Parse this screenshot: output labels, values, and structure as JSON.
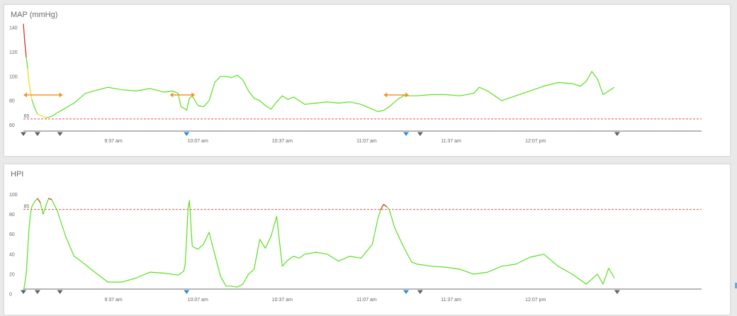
{
  "chart_data": [
    {
      "type": "line",
      "title": "MAP (mmHg)",
      "xlabel": "",
      "ylabel": "",
      "ylim": [
        55,
        150
      ],
      "yticks": [
        60,
        80,
        100,
        120,
        140
      ],
      "xlim_minutes": [
        0,
        240
      ],
      "x_tick_labels": [
        "9:37 am",
        "10:07 am",
        "10:37 am",
        "11:07 am",
        "11:37 am",
        "12:07 pm"
      ],
      "x_tick_minutes": [
        32,
        62,
        92,
        122,
        152,
        182
      ],
      "threshold": {
        "value": 65,
        "label": "65",
        "color": "#e05555"
      },
      "colors": {
        "normal": "#58e01c",
        "warning": "#f5e23c",
        "alarm": "#d93a3a"
      },
      "series": [
        {
          "x": [
            0,
            0.5,
            1,
            1.5,
            2,
            3,
            4,
            5,
            6,
            8,
            10,
            12,
            15,
            18,
            20,
            22,
            25,
            30,
            35,
            40,
            45,
            50,
            53,
            55,
            56,
            57,
            58,
            59,
            60,
            62,
            64,
            66,
            68,
            70,
            72,
            74,
            76,
            78,
            80,
            82,
            84,
            86,
            88,
            90,
            92,
            94,
            96,
            98,
            100,
            104,
            108,
            112,
            116,
            120,
            122,
            124,
            126,
            128,
            130,
            133,
            135,
            140,
            145,
            150,
            155,
            160,
            162,
            165,
            170,
            175,
            180,
            185,
            190,
            195,
            198,
            200,
            202,
            204,
            206,
            208,
            210
          ],
          "y": [
            143,
            128,
            116,
            106,
            95,
            81,
            74,
            69,
            68,
            66,
            67,
            70,
            74,
            78,
            82,
            86,
            88,
            91,
            89,
            88,
            90,
            87,
            88,
            86,
            75,
            74,
            72,
            82,
            84,
            76,
            75,
            80,
            95,
            100,
            100,
            99,
            101,
            97,
            88,
            82,
            80,
            76,
            73,
            79,
            84,
            81,
            83,
            80,
            77,
            78,
            79,
            78,
            79,
            77,
            75,
            73,
            71,
            72,
            75,
            81,
            84,
            84,
            85,
            85,
            84,
            86,
            91,
            88,
            80,
            84,
            88,
            92,
            95,
            94,
            92,
            96,
            104,
            98,
            85,
            88,
            91
          ],
          "alarm_points": [
            0,
            0.5,
            1
          ],
          "warning_points": [
            1.5,
            2,
            3,
            5,
            6,
            8,
            204
          ]
        }
      ],
      "event_arrows_minutes": [
        [
          0,
          14
        ],
        [
          52,
          61
        ],
        [
          128,
          137
        ]
      ],
      "markers_gray_minutes": [
        0,
        5,
        13,
        141,
        211
      ],
      "markers_blue_minutes": [
        58,
        136
      ]
    },
    {
      "type": "line",
      "title": "HPI",
      "xlabel": "",
      "ylabel": "",
      "ylim": [
        0,
        105
      ],
      "yticks": [
        0,
        20,
        40,
        60,
        80,
        100
      ],
      "xlim_minutes": [
        0,
        240
      ],
      "x_tick_labels": [
        "9:37 am",
        "10:07 am",
        "10:37 am",
        "11:07 am",
        "11:37 am",
        "12:07 pm"
      ],
      "x_tick_minutes": [
        32,
        62,
        92,
        122,
        152,
        182
      ],
      "threshold": {
        "value": 85,
        "label": "85",
        "color": "#e05555"
      },
      "colors": {
        "normal": "#58e01c",
        "alarm": "#d93a3a"
      },
      "series": [
        {
          "x": [
            0,
            1,
            2,
            2.5,
            3,
            4,
            5,
            6,
            7,
            8,
            9,
            10,
            12,
            15,
            18,
            20,
            24,
            30,
            35,
            40,
            45,
            50,
            55,
            57,
            57.5,
            58,
            58.5,
            59,
            60,
            62,
            64,
            66,
            68,
            70,
            72,
            74,
            76,
            78,
            80,
            82,
            84,
            86,
            88,
            90,
            92,
            94,
            96,
            98,
            100,
            104,
            108,
            112,
            116,
            120,
            124,
            126,
            127,
            128,
            129,
            130,
            132,
            135,
            138,
            140,
            145,
            150,
            155,
            160,
            165,
            170,
            175,
            180,
            185,
            190,
            195,
            200,
            202,
            204,
            206,
            208,
            210
          ],
          "y": [
            2,
            20,
            65,
            80,
            88,
            93,
            96,
            92,
            80,
            89,
            96,
            95,
            84,
            58,
            38,
            34,
            25,
            12,
            12,
            16,
            22,
            21,
            19,
            23,
            30,
            55,
            86,
            94,
            48,
            45,
            50,
            62,
            40,
            18,
            8,
            8,
            7,
            10,
            20,
            25,
            55,
            46,
            58,
            78,
            28,
            34,
            38,
            36,
            40,
            42,
            40,
            33,
            38,
            36,
            50,
            76,
            85,
            90,
            88,
            85,
            66,
            48,
            32,
            30,
            28,
            27,
            25,
            20,
            22,
            28,
            30,
            37,
            40,
            28,
            20,
            10,
            15,
            20,
            10,
            26,
            16
          ],
          "alarm_points": [
            5,
            6,
            9,
            10,
            58.5,
            127,
            128,
            129
          ]
        }
      ],
      "markers_gray_minutes": [
        0,
        5,
        13,
        141,
        211
      ],
      "markers_blue_minutes": [
        58,
        136
      ]
    }
  ]
}
